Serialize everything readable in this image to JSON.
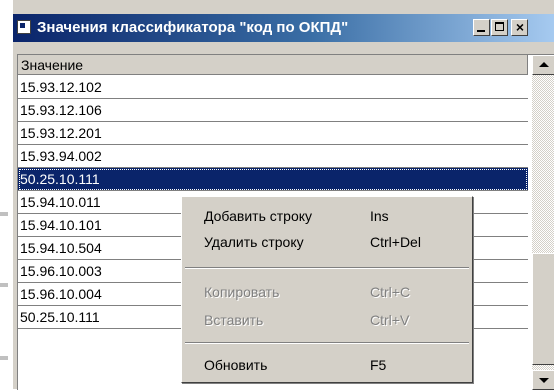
{
  "window": {
    "title": "Значения классификатора \"код по ОКПД\"",
    "controls": {
      "minimize": "_",
      "maximize": "□",
      "close": "×"
    }
  },
  "grid": {
    "column_header": "Значение",
    "rows": [
      {
        "value": "15.93.12.102",
        "selected": false
      },
      {
        "value": "15.93.12.106",
        "selected": false
      },
      {
        "value": "15.93.12.201",
        "selected": false
      },
      {
        "value": "15.93.94.002",
        "selected": false
      },
      {
        "value": "50.25.10.111",
        "selected": true
      },
      {
        "value": "15.94.10.011",
        "selected": false
      },
      {
        "value": "15.94.10.101",
        "selected": false
      },
      {
        "value": "15.94.10.504",
        "selected": false
      },
      {
        "value": "15.96.10.003",
        "selected": false
      },
      {
        "value": "15.96.10.004",
        "selected": false
      },
      {
        "value": "50.25.10.111",
        "selected": false
      }
    ]
  },
  "context_menu": {
    "items": [
      {
        "label": "Добавить строку",
        "shortcut": "Ins",
        "enabled": true
      },
      {
        "label": "Удалить строку",
        "shortcut": "Ctrl+Del",
        "enabled": true
      },
      {
        "label": "Копировать",
        "shortcut": "Ctrl+C",
        "enabled": false
      },
      {
        "label": "Вставить",
        "shortcut": "Ctrl+V",
        "enabled": false
      },
      {
        "label": "Обновить",
        "shortcut": "F5",
        "enabled": true
      }
    ]
  },
  "colors": {
    "title_bar": "#0a246a",
    "selection": "#0a246a",
    "face": "#d4d0c8"
  }
}
